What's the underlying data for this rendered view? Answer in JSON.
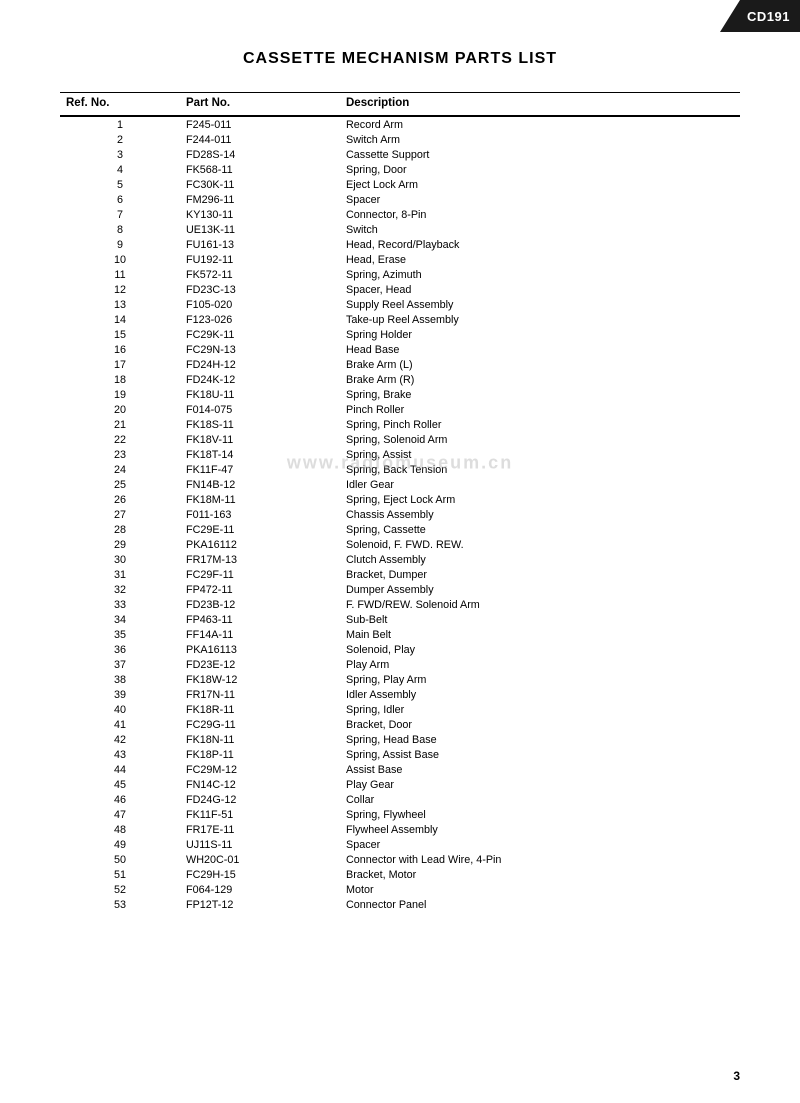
{
  "badge": {
    "text": "CD191"
  },
  "title": "CASSETTE MECHANISM PARTS LIST",
  "table": {
    "headers": [
      "Ref. No.",
      "Part No.",
      "Description"
    ],
    "rows": [
      [
        "1",
        "F245-011",
        "Record Arm"
      ],
      [
        "2",
        "F244-011",
        "Switch Arm"
      ],
      [
        "3",
        "FD28S-14",
        "Cassette Support"
      ],
      [
        "4",
        "FK568-11",
        "Spring, Door"
      ],
      [
        "5",
        "FC30K-11",
        "Eject Lock Arm"
      ],
      [
        "6",
        "FM296-11",
        "Spacer"
      ],
      [
        "7",
        "KY130-11",
        "Connector, 8-Pin"
      ],
      [
        "8",
        "UE13K-11",
        "Switch"
      ],
      [
        "9",
        "FU161-13",
        "Head, Record/Playback"
      ],
      [
        "10",
        "FU192-11",
        "Head, Erase"
      ],
      [
        "11",
        "FK572-11",
        "Spring, Azimuth"
      ],
      [
        "12",
        "FD23C-13",
        "Spacer, Head"
      ],
      [
        "13",
        "F105-020",
        "Supply Reel Assembly"
      ],
      [
        "14",
        "F123-026",
        "Take-up Reel Assembly"
      ],
      [
        "15",
        "FC29K-11",
        "Spring Holder"
      ],
      [
        "16",
        "FC29N-13",
        "Head Base"
      ],
      [
        "17",
        "FD24H-12",
        "Brake Arm (L)"
      ],
      [
        "18",
        "FD24K-12",
        "Brake Arm (R)"
      ],
      [
        "19",
        "FK18U-11",
        "Spring, Brake"
      ],
      [
        "20",
        "F014-075",
        "Pinch Roller"
      ],
      [
        "21",
        "FK18S-11",
        "Spring, Pinch Roller"
      ],
      [
        "22",
        "FK18V-11",
        "Spring, Solenoid Arm"
      ],
      [
        "23",
        "FK18T-14",
        "Spring, Assist"
      ],
      [
        "24",
        "FK11F-47",
        "Spring, Back Tension"
      ],
      [
        "25",
        "FN14B-12",
        "Idler Gear"
      ],
      [
        "26",
        "FK18M-11",
        "Spring, Eject Lock Arm"
      ],
      [
        "27",
        "F011-163",
        "Chassis Assembly"
      ],
      [
        "28",
        "FC29E-11",
        "Spring, Cassette"
      ],
      [
        "29",
        "PKA16112",
        "Solenoid, F. FWD. REW."
      ],
      [
        "30",
        "FR17M-13",
        "Clutch Assembly"
      ],
      [
        "31",
        "FC29F-11",
        "Bracket, Dumper"
      ],
      [
        "32",
        "FP472-11",
        "Dumper Assembly"
      ],
      [
        "33",
        "FD23B-12",
        "F. FWD/REW. Solenoid Arm"
      ],
      [
        "34",
        "FP463-11",
        "Sub-Belt"
      ],
      [
        "35",
        "FF14A-11",
        "Main Belt"
      ],
      [
        "36",
        "PKA16113",
        "Solenoid, Play"
      ],
      [
        "37",
        "FD23E-12",
        "Play Arm"
      ],
      [
        "38",
        "FK18W-12",
        "Spring, Play Arm"
      ],
      [
        "39",
        "FR17N-11",
        "Idler Assembly"
      ],
      [
        "40",
        "FK18R-11",
        "Spring, Idler"
      ],
      [
        "41",
        "FC29G-11",
        "Bracket, Door"
      ],
      [
        "42",
        "FK18N-11",
        "Spring, Head Base"
      ],
      [
        "43",
        "FK18P-11",
        "Spring, Assist Base"
      ],
      [
        "44",
        "FC29M-12",
        "Assist Base"
      ],
      [
        "45",
        "FN14C-12",
        "Play Gear"
      ],
      [
        "46",
        "FD24G-12",
        "Collar"
      ],
      [
        "47",
        "FK11F-51",
        "Spring, Flywheel"
      ],
      [
        "48",
        "FR17E-11",
        "Flywheel Assembly"
      ],
      [
        "49",
        "UJ11S-11",
        "Spacer"
      ],
      [
        "50",
        "WH20C-01",
        "Connector with Lead Wire, 4-Pin"
      ],
      [
        "51",
        "FC29H-15",
        "Bracket, Motor"
      ],
      [
        "52",
        "F064-129",
        "Motor"
      ],
      [
        "53",
        "FP12T-12",
        "Connector Panel"
      ]
    ]
  },
  "watermark": "www.radiomuseum.cn",
  "page_number": "3"
}
